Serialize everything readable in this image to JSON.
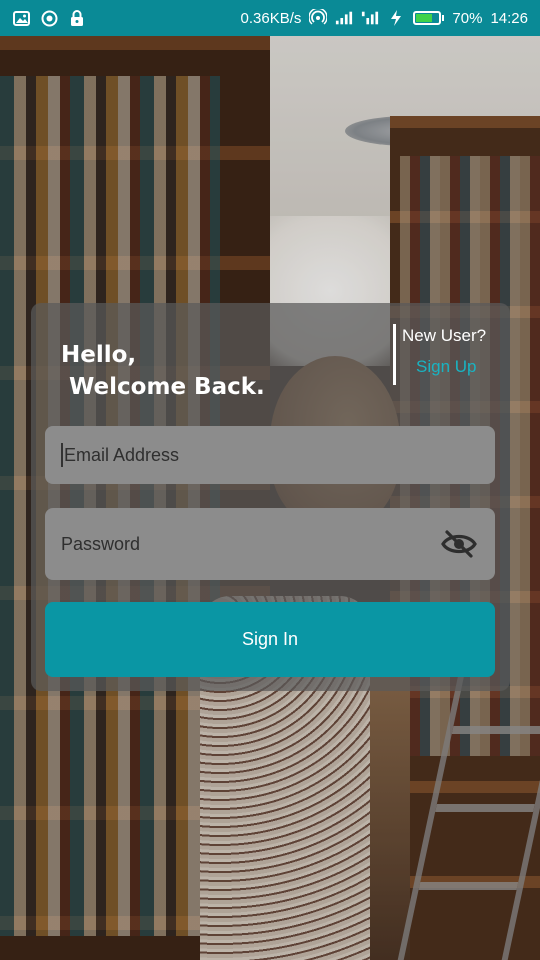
{
  "status_bar": {
    "left_icons": [
      "image-icon",
      "sync-icon",
      "lock-icon"
    ],
    "speed": "0.36KB/s",
    "battery_percent": "70%",
    "battery_level": 0.7,
    "time": "14:26",
    "accent_color": "#0a8a96"
  },
  "card": {
    "greeting": "Hello,\n Welcome Back.",
    "new_user_label": "New User?",
    "sign_up_label": "Sign Up",
    "email_placeholder": "Email Address",
    "password_placeholder": "Password",
    "password_visibility_icon": "eye-off-icon",
    "sign_in_label": "Sign In",
    "button_color": "#0a96a4",
    "link_color": "#19b3c2"
  }
}
